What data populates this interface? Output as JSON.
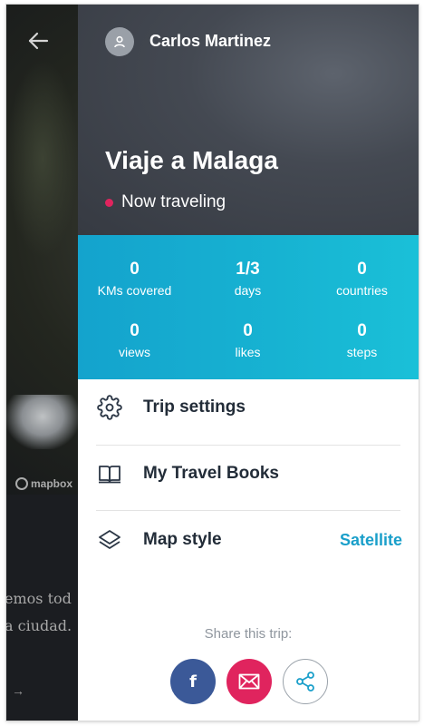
{
  "background": {
    "back_icon": "arrow-left-icon",
    "map_attribution": "mapbox",
    "story_lines": [
      "emos tod",
      "a ciudad."
    ],
    "story_arrow": "→"
  },
  "drawer": {
    "user": {
      "name": "Carlos Martinez",
      "avatar_icon": "user-icon"
    },
    "trip": {
      "title": "Viaje a Malaga",
      "status": "Now traveling",
      "status_color": "#e0245e"
    },
    "stats": [
      {
        "value": "0",
        "label": "KMs covered"
      },
      {
        "value": "1/3",
        "label": "days"
      },
      {
        "value": "0",
        "label": "countries"
      },
      {
        "value": "0",
        "label": "views"
      },
      {
        "value": "0",
        "label": "likes"
      },
      {
        "value": "0",
        "label": "steps"
      }
    ],
    "menu": [
      {
        "label": "Trip settings",
        "icon": "gear-icon"
      },
      {
        "label": "My Travel Books",
        "icon": "book-icon"
      },
      {
        "label": "Map style",
        "icon": "layers-icon",
        "value": "Satellite"
      }
    ],
    "share": {
      "label": "Share this trip:",
      "facebook": "f",
      "facebook_color": "#3b5998",
      "email_color": "#e0245e"
    }
  },
  "colors": {
    "accent": "#1a9fca",
    "stats_bg": "#17b3d2",
    "header_bg": "#444952"
  }
}
